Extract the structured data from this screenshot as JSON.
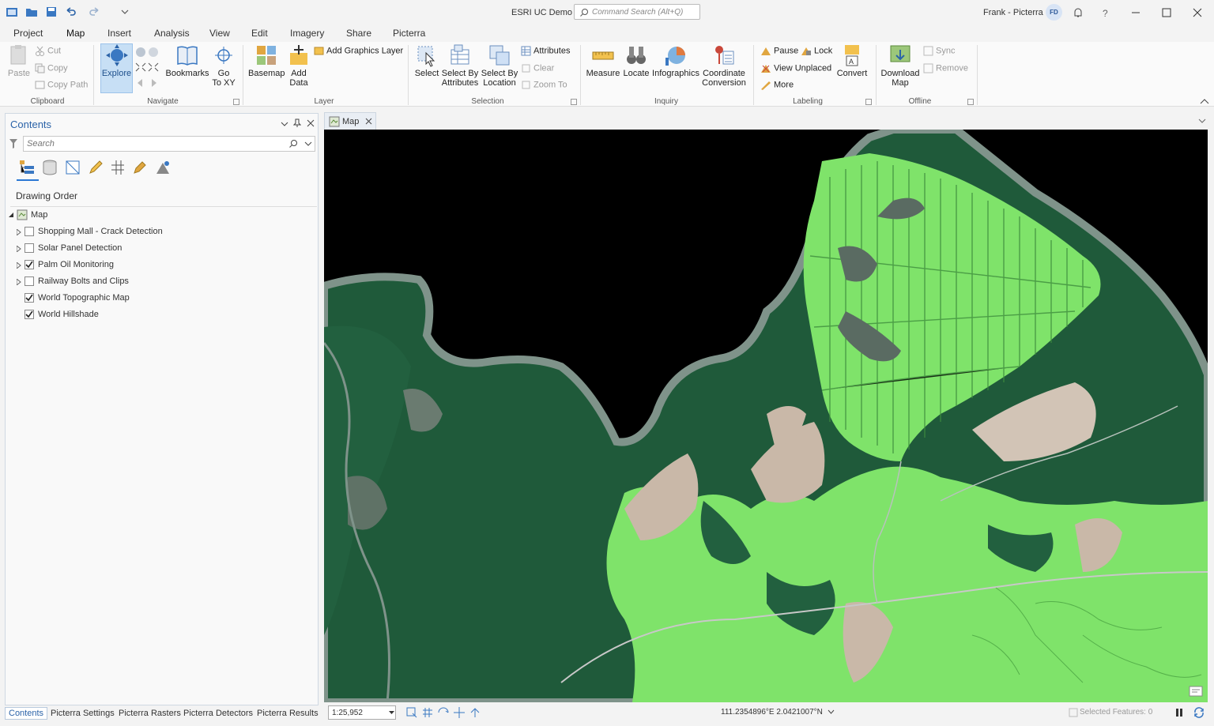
{
  "app": {
    "title": "ESRI UC Demo",
    "user": "Frank - Picterra",
    "avatar_initials": "FD",
    "command_search_placeholder": "Command Search (Alt+Q)"
  },
  "ribbon_tabs": [
    "Project",
    "Map",
    "Insert",
    "Analysis",
    "View",
    "Edit",
    "Imagery",
    "Share",
    "Picterra"
  ],
  "active_tab": "Map",
  "ribbon": {
    "clipboard": {
      "label": "Clipboard",
      "paste": "Paste",
      "cut": "Cut",
      "copy": "Copy",
      "copy_path": "Copy Path"
    },
    "navigate": {
      "label": "Navigate",
      "explore": "Explore",
      "bookmarks": "Bookmarks",
      "goto": "Go",
      "goto2": "To XY"
    },
    "layer": {
      "label": "Layer",
      "basemap": "Basemap",
      "add": "Add",
      "add2": "Data",
      "add_graphics": "Add Graphics Layer"
    },
    "selection": {
      "label": "Selection",
      "select": "Select",
      "select_by_attr": "Select By",
      "select_by_attr2": "Attributes",
      "select_by_loc": "Select By",
      "select_by_loc2": "Location",
      "attributes": "Attributes",
      "clear": "Clear",
      "zoom_to": "Zoom To"
    },
    "inquiry": {
      "label": "Inquiry",
      "measure": "Measure",
      "locate": "Locate",
      "infographics": "Infographics",
      "coord": "Coordinate",
      "coord2": "Conversion"
    },
    "labeling": {
      "label": "Labeling",
      "pause": "Pause",
      "lock": "Lock",
      "view_unplaced": "View Unplaced",
      "more": "More",
      "convert": "Convert"
    },
    "offline": {
      "label": "Offline",
      "download": "Download",
      "download2": "Map",
      "sync": "Sync",
      "remove": "Remove"
    }
  },
  "contents": {
    "title": "Contents",
    "search_placeholder": "Search",
    "drawing_order": "Drawing Order",
    "root": "Map",
    "layers": [
      {
        "name": "Shopping Mall - Crack Detection",
        "checked": false,
        "expandable": true
      },
      {
        "name": "Solar Panel Detection",
        "checked": false,
        "expandable": true
      },
      {
        "name": "Palm Oil Monitoring",
        "checked": true,
        "expandable": true
      },
      {
        "name": "Railway Bolts and Clips",
        "checked": false,
        "expandable": true
      },
      {
        "name": "World Topographic Map",
        "checked": true,
        "expandable": false
      },
      {
        "name": "World Hillshade",
        "checked": true,
        "expandable": false
      }
    ]
  },
  "bottom_tabs": [
    "Contents",
    "Picterra Settings",
    "Picterra Rasters",
    "Picterra Detectors",
    "Picterra Results"
  ],
  "map_tab": "Map",
  "status": {
    "scale": "1:25,952",
    "coords": "111.2354896°E 2.0421007°N",
    "selected_features": "Selected Features: 0"
  },
  "colors": {
    "accent": "#2b78d4",
    "forest": "#1f5a3a",
    "palm_detection": "#7fe36a",
    "water": "#000000",
    "river": "#7f938a"
  }
}
